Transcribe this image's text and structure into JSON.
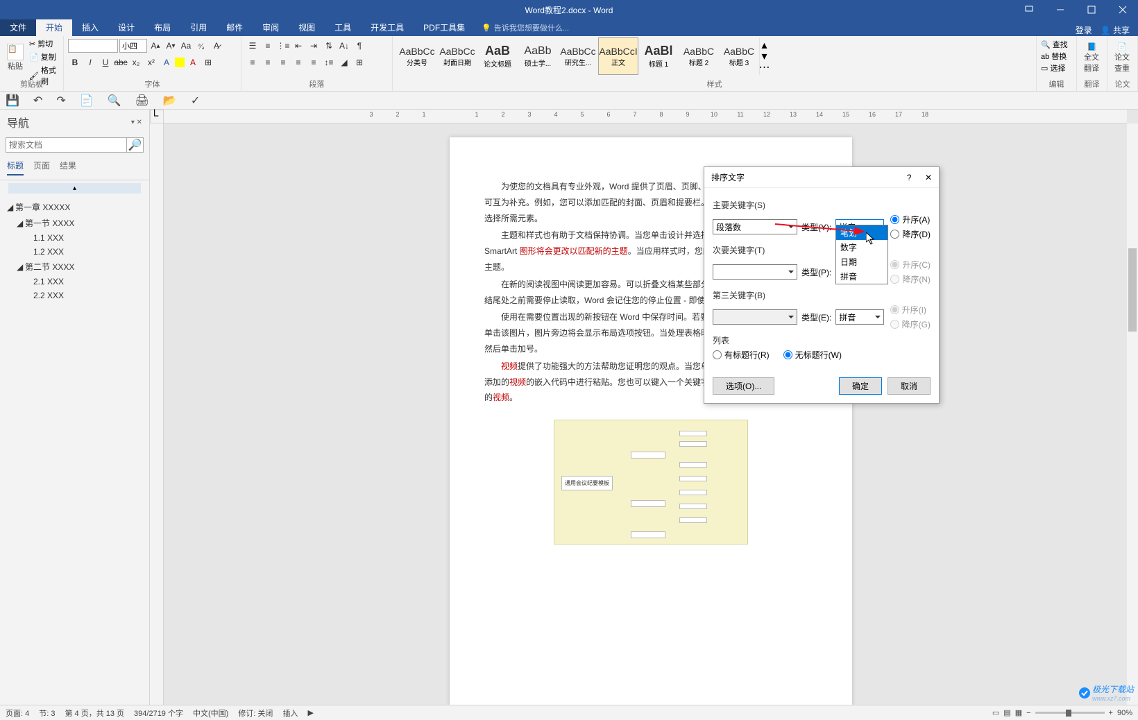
{
  "titlebar": {
    "title": "Word教程2.docx - Word"
  },
  "menu": {
    "file": "文件",
    "home": "开始",
    "insert": "插入",
    "design": "设计",
    "layout": "布局",
    "references": "引用",
    "mailings": "邮件",
    "review": "审阅",
    "view": "视图",
    "tools": "工具",
    "dev": "开发工具",
    "pdf": "PDF工具集",
    "tellme": "告诉我您想要做什么...",
    "login": "登录",
    "share": "共享"
  },
  "ribbon": {
    "clipboard": {
      "label": "剪贴板",
      "paste": "粘贴",
      "cut": "剪切",
      "copy": "复制",
      "format_painter": "格式刷"
    },
    "font": {
      "label": "字体",
      "name": "",
      "size": "小四"
    },
    "paragraph": {
      "label": "段落"
    },
    "styles": {
      "label": "样式",
      "items": [
        {
          "preview": "AaBbCc",
          "name": "分类号"
        },
        {
          "preview": "AaBbCc",
          "name": "封面日期"
        },
        {
          "preview": "AaB",
          "name": "论文标题"
        },
        {
          "preview": "AaBb",
          "name": "硕士学..."
        },
        {
          "preview": "AaBbCc",
          "name": "研究生..."
        },
        {
          "preview": "AaBbCcI",
          "name": "正文"
        },
        {
          "preview": "AaBl",
          "name": "标题 1"
        },
        {
          "preview": "AaBbC",
          "name": "标题 2"
        },
        {
          "preview": "AaBbC",
          "name": "标题 3"
        }
      ]
    },
    "editing": {
      "label": "编辑",
      "find": "查找",
      "replace": "替换",
      "select": "选择"
    },
    "translate": {
      "label": "翻译",
      "btn": "全文翻译"
    },
    "check": {
      "label": "论文",
      "btn": "论文查重"
    }
  },
  "nav": {
    "title": "导航",
    "search_placeholder": "搜索文档",
    "tabs": {
      "headings": "标题",
      "pages": "页面",
      "results": "结果"
    },
    "tree": [
      {
        "level": 0,
        "text": "第一章 XXXXX",
        "expanded": true
      },
      {
        "level": 1,
        "text": "第一节 XXXX",
        "expanded": true
      },
      {
        "level": 2,
        "text": "1.1 XXX"
      },
      {
        "level": 2,
        "text": "1.2 XXX"
      },
      {
        "level": 1,
        "text": "第二节 XXXX",
        "expanded": true
      },
      {
        "level": 2,
        "text": "2.1 XXX"
      },
      {
        "level": 2,
        "text": "2.2 XXX"
      }
    ]
  },
  "doc": {
    "p1a": "为使您的文档具有专业外观，Word 提供了页眉、页脚、封面和文本框设计，这些设计可互为补充。例如，您可以添加匹配的封面、页眉和提要栏。单击\"插入\"，然后从不同库中选择所需元素。",
    "p2a": "主题和样式也有助于文档保持协调。当您单击设计并选择新的主题时，图片、图表或 SmartArt ",
    "p2b": "图形将会更改以匹配新的主题",
    "p2c": "。当应用样式时，您的标题会进行更改以匹配新的主题。",
    "p3": "在新的阅读视图中阅读更加容易。可以折叠文档某些部分并关注所需文本。如果在达到结尾处之前需要停止读取，Word 会记住您的停止位置 - 即使在另一个设备上。",
    "p4a": "使用在需要位置出现的新按钮在 Word 中保存时间。若要更改图片适应文档的方式，请单击该图片，图片旁边将会显示布局选项按钮。当处理表格时，单击要添加行或列的位置，然后单击加号。",
    "p5a": "视频",
    "p5b": "提供了功能强大的方法帮助您证明您的观点。当您单击联机",
    "p5c": "视频",
    "p5d": "时，可以在想要添加的",
    "p5e": "视频",
    "p5f": "的嵌入代码中进行粘贴。您也可以键入一个关键字以联机搜索最适合您的文档的",
    "p5g": "视频",
    "p5h": "。",
    "diagram_center": "通用会议纪要模板"
  },
  "dialog": {
    "title": "排序文字",
    "key1_label": "主要关键字(S)",
    "key1_value": "段落数",
    "type_y_label": "类型(Y):",
    "type_y_value": "拼音",
    "asc_a": "升序(A)",
    "desc_d": "降序(D)",
    "key2_label": "次要关键字(T)",
    "type_p_label": "类型(P):",
    "asc_c": "升序(C)",
    "desc_n": "降序(N)",
    "key3_label": "第三关键字(B)",
    "type_e_label": "类型(E):",
    "type_e_value": "拼音",
    "asc_i": "升序(I)",
    "desc_g": "降序(G)",
    "list_label": "列表",
    "has_header": "有标题行(R)",
    "no_header": "无标题行(W)",
    "options": "选项(O)...",
    "ok": "确定",
    "cancel": "取消"
  },
  "dropdown": {
    "items": [
      "笔划",
      "数字",
      "日期",
      "拼音"
    ]
  },
  "status": {
    "page": "页面: 4",
    "section": "节: 3",
    "page_of": "第 4 页，共 13 页",
    "words": "394/2719 个字",
    "lang": "中文(中国)",
    "track": "修订: 关闭",
    "insert": "插入",
    "zoom": "90%"
  },
  "watermark": "极光下载站",
  "watermark_url": "www.xz7.com"
}
